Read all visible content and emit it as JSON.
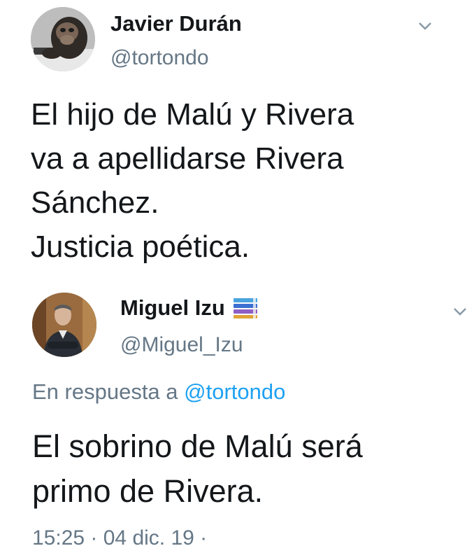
{
  "tweet1": {
    "author_name": "Javier Durán",
    "handle": "@tortondo",
    "avatar_icon": "chimpanzee-avatar",
    "menu_icon": "chevron-down-icon",
    "text_lines": [
      "El hijo de Malú y Rivera",
      "va a apellidarse Rivera",
      "Sánchez.",
      "Justicia poética."
    ]
  },
  "tweet2": {
    "author_name": "Miguel Izu",
    "name_badge_icon": "books-emoji-icon",
    "handle": "@Miguel_Izu",
    "avatar_icon": "man-portrait-avatar",
    "menu_icon": "chevron-down-icon",
    "reply_prefix": "En respuesta a",
    "reply_mention": "@tortondo",
    "text_lines": [
      "El sobrino de Malú será",
      "primo de Rivera."
    ],
    "timestamp": "15:25 · 04 dic. 19 ·"
  },
  "colors": {
    "text": "#14171a",
    "secondary": "#657786",
    "link": "#1da1f2"
  }
}
